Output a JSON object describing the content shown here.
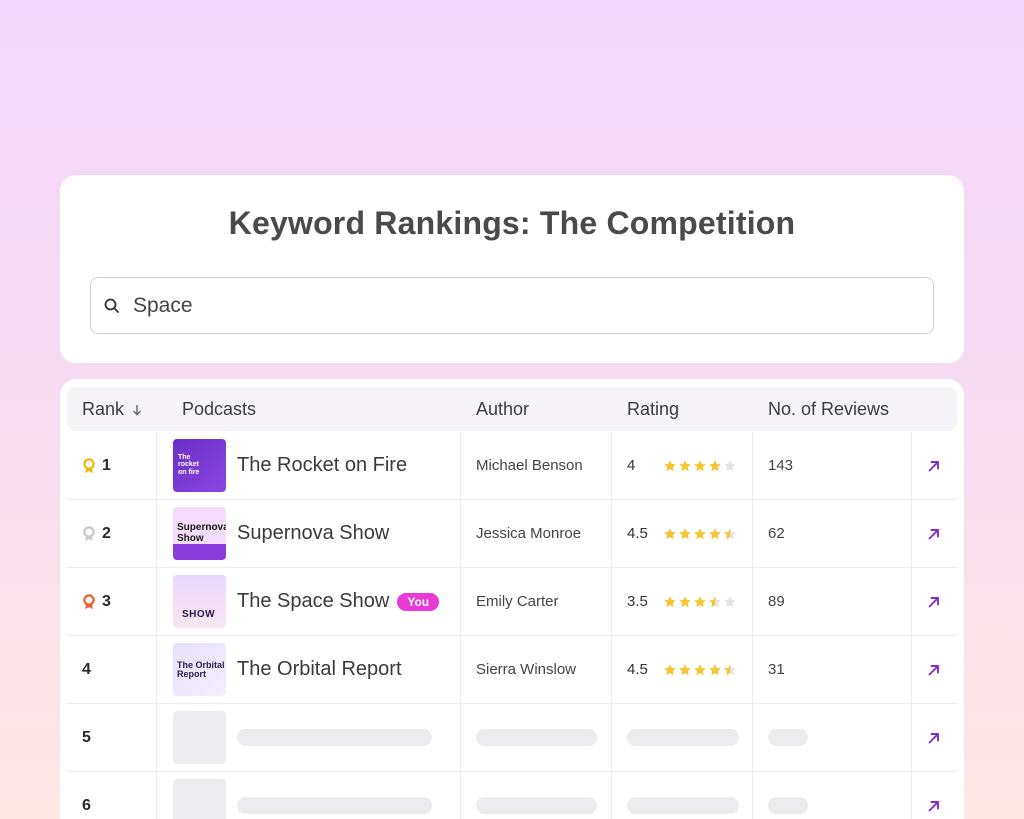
{
  "title": "Keyword Rankings: The Competition",
  "search": {
    "value": "Space",
    "icon": "search-icon"
  },
  "columns": {
    "rank": "Rank",
    "podcasts": "Podcasts",
    "author": "Author",
    "rating": "Rating",
    "reviews": "No. of Reviews"
  },
  "colors": {
    "accent": "#7b2fd0",
    "you_badge": "#e93ad6",
    "gold": "#f2b705",
    "silver": "#c7c7cc",
    "bronze": "#f05a2a",
    "star": "#f7c531",
    "star_empty": "#e3e3e6"
  },
  "rows": [
    {
      "rank": "1",
      "medal": "gold",
      "podcast": "The Rocket on Fire",
      "thumb_text": "The rocket on fire",
      "author": "Michael Benson",
      "rating": "4",
      "rating_value": 4,
      "reviews": "143",
      "you": ""
    },
    {
      "rank": "2",
      "medal": "silver",
      "podcast": "Supernova Show",
      "thumb_text": "Supernova Show",
      "author": "Jessica Monroe",
      "rating": "4.5",
      "rating_value": 4.5,
      "reviews": "62",
      "you": ""
    },
    {
      "rank": "3",
      "medal": "bronze",
      "podcast": "The Space Show",
      "thumb_text": "SHOW",
      "author": "Emily Carter",
      "rating": "3.5",
      "rating_value": 3.5,
      "reviews": "89",
      "you": "You"
    },
    {
      "rank": "4",
      "medal": "",
      "podcast": "The Orbital Report",
      "thumb_text": "The Orbital Report",
      "author": "Sierra Winslow",
      "rating": "4.5",
      "rating_value": 4.5,
      "reviews": "31",
      "you": ""
    },
    {
      "rank": "5",
      "placeholder": true
    },
    {
      "rank": "6",
      "placeholder": true
    }
  ]
}
